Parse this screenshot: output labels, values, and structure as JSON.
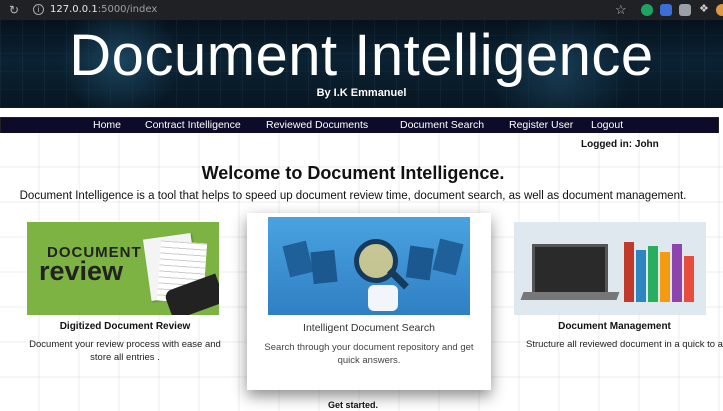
{
  "browser": {
    "url_host": "127.0.0.1",
    "url_rest": ":5000/index"
  },
  "banner": {
    "title": "Document Intelligence",
    "byline": "By I.K Emmanuel"
  },
  "nav": {
    "items": [
      "Home",
      "Contract Intelligence",
      "Reviewed Documents",
      "Document Search",
      "Register User",
      "Logout"
    ]
  },
  "status": {
    "logged_in": "Logged in: John"
  },
  "main": {
    "heading": "Welcome to Document Intelligence.",
    "intro": "Document Intelligence is a tool that helps to speed up document review time, document search, as well as document management.",
    "cards": [
      {
        "title": "Digitized Document Review",
        "desc": "Document your review process with ease and store all entries .",
        "image_text_1": "DOCUMENT",
        "image_text_2": "review"
      },
      {
        "title": "Intelligent Document Search",
        "desc": "Search through your document repository and get quick answers."
      },
      {
        "title": "Document Management",
        "desc": "Structure all reviewed document in a quick to access manner"
      }
    ],
    "footer_link": "Get started."
  },
  "colors": {
    "nav_bg": "#0c0c2a",
    "banner_bg": "#0b2233",
    "review_green": "#7cb342",
    "search_blue": "#3a8fd0"
  }
}
